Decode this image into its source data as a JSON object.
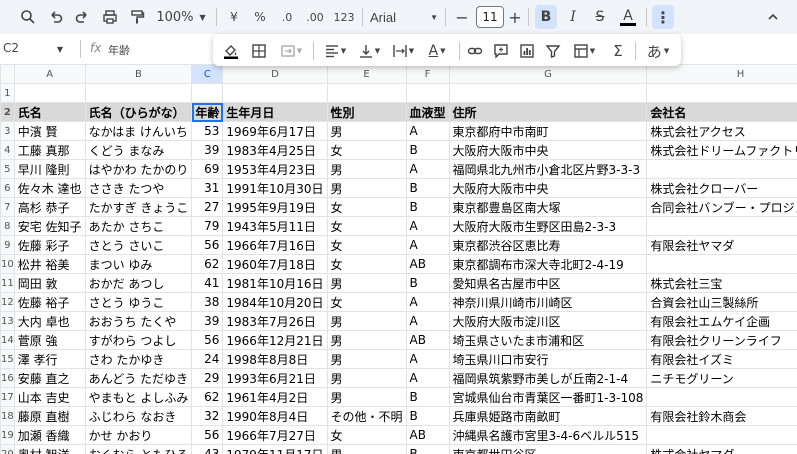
{
  "toolbar": {
    "zoom": "100%",
    "currency": "¥",
    "percent": "%",
    "dec_decrease": ".0",
    "dec_increase": ".00",
    "number_format": "123",
    "font": "Arial",
    "font_size": "11",
    "minus": "−",
    "plus": "+",
    "bold": "B",
    "italic": "I",
    "strike": "S",
    "text_color": "A"
  },
  "formula_bar": {
    "cell_ref": "C2",
    "fx": "fx",
    "value": "年齢"
  },
  "popup": {
    "japanese_input": "あ",
    "sigma": "Σ"
  },
  "columns": [
    "A",
    "B",
    "C",
    "D",
    "E",
    "F",
    "G",
    "H"
  ],
  "rows": [
    {
      "n": "1",
      "cells": [
        "",
        "",
        "",
        "",
        "",
        "",
        "",
        ""
      ]
    },
    {
      "n": "2",
      "cells": [
        "氏名",
        "氏名（ひらがな）",
        "年齢",
        "生年月日",
        "性別",
        "血液型",
        "住所",
        "会社名"
      ]
    },
    {
      "n": "3",
      "cells": [
        "中濱 賢",
        "なかはま けんいち",
        "53",
        "1969年6月17日",
        "男",
        "A",
        "東京都府中市南町",
        "株式会社アクセス"
      ]
    },
    {
      "n": "4",
      "cells": [
        "工藤 真那",
        "くどう まなみ",
        "39",
        "1983年4月25日",
        "女",
        "B",
        "大阪府大阪市中央",
        "株式会社ドリームファクトリー"
      ]
    },
    {
      "n": "5",
      "cells": [
        "早川 隆則",
        "はやかわ たかのり",
        "69",
        "1953年4月23日",
        "男",
        "A",
        "福岡県北九州市小倉北区片野3-3-3",
        ""
      ]
    },
    {
      "n": "6",
      "cells": [
        "佐々木 達也",
        "ささき たつや",
        "31",
        "1991年10月30日",
        "男",
        "B",
        "大阪府大阪市中央",
        "株式会社クローバー"
      ]
    },
    {
      "n": "7",
      "cells": [
        "高杉 恭子",
        "たかすぎ きょうこ",
        "27",
        "1995年9月19日",
        "女",
        "B",
        "東京都豊島区南大塚",
        "合同会社バンブー・プロジェクト"
      ]
    },
    {
      "n": "8",
      "cells": [
        "安宅 佐知子",
        "あたか さちこ",
        "79",
        "1943年5月11日",
        "女",
        "A",
        "大阪府大阪市生野区田島2-3-3",
        ""
      ]
    },
    {
      "n": "9",
      "cells": [
        "佐藤 彩子",
        "さとう さいこ",
        "56",
        "1966年7月16日",
        "女",
        "A",
        "東京都渋谷区恵比寿",
        "有限会社ヤマダ"
      ]
    },
    {
      "n": "10",
      "cells": [
        "松井 裕美",
        "まつい ゆみ",
        "62",
        "1960年7月18日",
        "女",
        "AB",
        "東京都調布市深大寺北町2-4-19",
        ""
      ]
    },
    {
      "n": "11",
      "cells": [
        "岡田 敦",
        "おかだ あつし",
        "41",
        "1981年10月16日",
        "男",
        "B",
        "愛知県名古屋市中区",
        "株式会社三宝"
      ]
    },
    {
      "n": "12",
      "cells": [
        "佐藤 裕子",
        "さとう ゆうこ",
        "38",
        "1984年10月20日",
        "女",
        "A",
        "神奈川県川崎市川崎区",
        "合資会社山三製絲所"
      ]
    },
    {
      "n": "13",
      "cells": [
        "大内 卓也",
        "おおうち たくや",
        "39",
        "1983年7月26日",
        "男",
        "A",
        "大阪府大阪市淀川区",
        "有限会社エムケイ企画"
      ]
    },
    {
      "n": "14",
      "cells": [
        "菅原 強",
        "すがわら つよし",
        "56",
        "1966年12月21日",
        "男",
        "AB",
        "埼玉県さいたま市浦和区",
        "有限会社クリーンライフ"
      ]
    },
    {
      "n": "15",
      "cells": [
        "澤 孝行",
        "さわ たかゆき",
        "24",
        "1998年8月8日",
        "男",
        "A",
        "埼玉県川口市安行",
        "有限会社イズミ"
      ]
    },
    {
      "n": "16",
      "cells": [
        "安藤 直之",
        "あんどう ただゆき",
        "29",
        "1993年6月21日",
        "男",
        "A",
        "福岡県筑紫野市美しが丘南2-1-4",
        "ニチモグリーン"
      ]
    },
    {
      "n": "17",
      "cells": [
        "山本 吉史",
        "やまもと よしふみ",
        "62",
        "1961年4月2日",
        "男",
        "B",
        "宮城県仙台市青葉区一番町1-3-108",
        ""
      ]
    },
    {
      "n": "18",
      "cells": [
        "藤原 直樹",
        "ふじわら なおき",
        "32",
        "1990年8月4日",
        "その他・不明",
        "B",
        "兵庫県姫路市南畝町",
        "有限会社鈴木商会"
      ]
    },
    {
      "n": "19",
      "cells": [
        "加瀬 香織",
        "かせ かおり",
        "56",
        "1966年7月27日",
        "女",
        "AB",
        "沖縄県名護市宮里3-4-6ベルル515",
        ""
      ]
    },
    {
      "n": "20",
      "cells": [
        "奥村 智洋",
        "おくむら ともひろ",
        "43",
        "1979年11月17日",
        "男",
        "B",
        "東京都世田谷区",
        "株式会社ヤマダ"
      ]
    }
  ]
}
